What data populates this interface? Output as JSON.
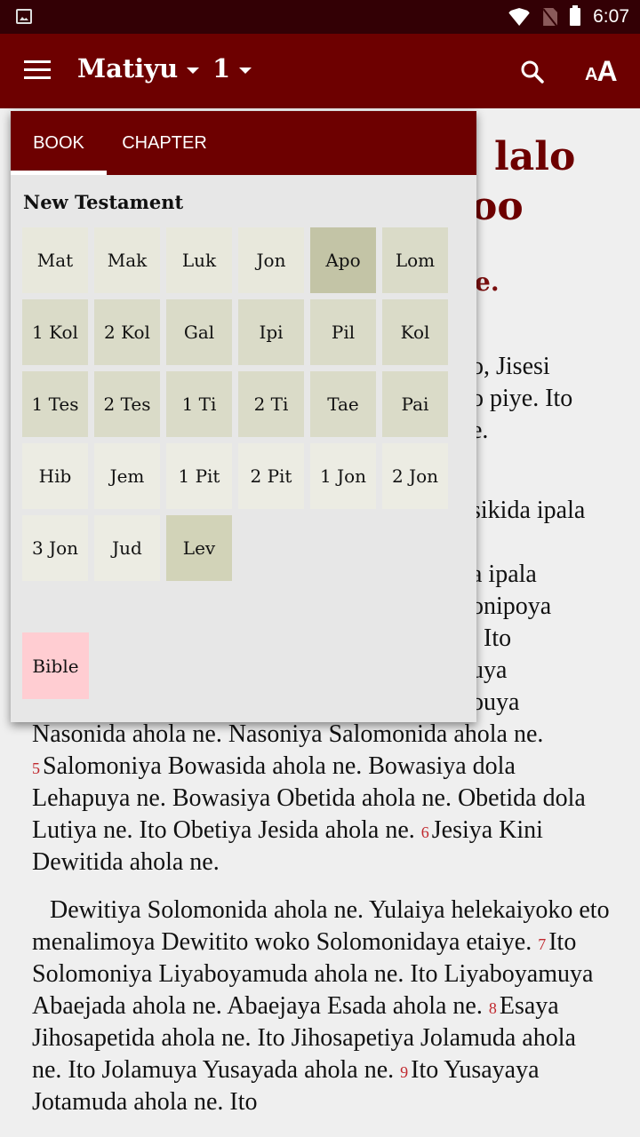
{
  "status_bar": {
    "time": "6:07",
    "icons": [
      "image-notification-icon",
      "wifi-icon",
      "no-sim-icon",
      "battery-icon"
    ]
  },
  "app_bar": {
    "book": "Matiyu",
    "chapter": "1",
    "icons": [
      "menu-icon",
      "search-icon",
      "font-size-icon"
    ]
  },
  "font_button": {
    "small": "A",
    "big": "A"
  },
  "colors": {
    "brand": "#6d0000",
    "status_bar": "#330005",
    "verse_number": "#c0272d",
    "selected_book": "#c3c4a6",
    "bible_button": "#ffcdd2"
  },
  "popup": {
    "tabs": [
      {
        "label": "BOOK",
        "active": true
      },
      {
        "label": "CHAPTER",
        "active": false
      }
    ],
    "section_title": "New Testament",
    "books": [
      "Mat",
      "Mak",
      "Luk",
      "Jon",
      "Apo",
      "Lom",
      "1 Kol",
      "2 Kol",
      "Gal",
      "Ipi",
      "Pil",
      "Kol",
      "1 Tes",
      "2 Tes",
      "1 Ti",
      "2 Ti",
      "Tae",
      "Pai",
      "Hib",
      "Jem",
      "1 Pit",
      "2 Pit",
      "1 Jon",
      "2 Jon",
      "3 Jon",
      "Jud",
      "Lev"
    ],
    "selected_book": "Apo",
    "bible_button": "Bible"
  },
  "content": {
    "heading_fragment_1": "lalo",
    "heading_fragment_2": "oo",
    "subheading_fragment": "e.",
    "partial_lines": [
      "o, Jisesi",
      "o piye. Ito",
      "e.",
      "sikida ipala",
      "a ipala",
      "onipoya",
      ". Ito",
      "uya",
      "ouya"
    ],
    "para1": [
      {
        "text": "Nasonida ahola ne. Nasoniya Salomonida ahola ne. "
      },
      {
        "verse": "5",
        "text": "Salomoniya Bowasida ahola ne. Bowasiya dola Lehapuya ne. Bowasiya Obetida ahola ne. Obetida dola Lutiya ne. Ito Obetiya Jesida ahola ne. "
      },
      {
        "verse": "6",
        "text": "Jesiya Kini Dewitida ahola ne."
      }
    ],
    "para2": [
      {
        "text": "Dewitiya Solomonida ahola ne. Yulaiya helekaiyoko eto menalimoya Dewitito woko Solomonidaya etaiye. "
      },
      {
        "verse": "7",
        "text": "Ito Solomoniya Liyaboyamuda ahola ne. Ito Liyaboyamuya Abaejada ahola ne. Abaejaya Esada ahola ne. "
      },
      {
        "verse": "8",
        "text": "Esaya Jihosapetida ahola ne. Ito Jihosapetiya Jolamuda ahola ne. Ito Jolamuya Yusayada ahola ne. "
      },
      {
        "verse": "9",
        "text": "Ito Yusayaya Jotamuda ahola ne. Ito"
      }
    ]
  }
}
